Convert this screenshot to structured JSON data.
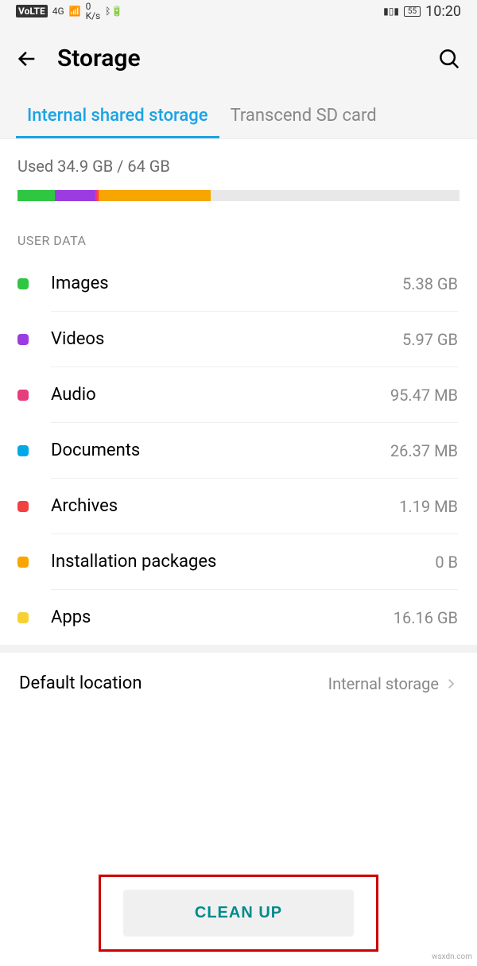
{
  "status_bar": {
    "volte": "VoLTE",
    "signal": "4G",
    "speed_top": "0",
    "speed_bottom": "K/s",
    "bluetooth_icon": "bluetooth",
    "vibrate_icon": "vibrate",
    "battery": "55",
    "time": "10:20"
  },
  "header": {
    "title": "Storage"
  },
  "tabs": [
    {
      "label": "Internal shared storage",
      "active": true
    },
    {
      "label": "Transcend SD card",
      "active": false
    }
  ],
  "usage": {
    "text": "Used 34.9 GB / 64 GB",
    "segments": [
      {
        "color": "#2FC641",
        "width": 8.4
      },
      {
        "color": "#9B3CE0",
        "width": 9.3
      },
      {
        "color": "#E73C7E",
        "width": 0.3
      },
      {
        "color": "#00A8E8",
        "width": 0.2
      },
      {
        "color": "#F04242",
        "width": 0.2
      },
      {
        "color": "#F7A600",
        "width": 25.3
      }
    ]
  },
  "section_header": "USER DATA",
  "categories": [
    {
      "name": "Images",
      "size": "5.38 GB",
      "color": "#2FC641"
    },
    {
      "name": "Videos",
      "size": "5.97 GB",
      "color": "#9B3CE0"
    },
    {
      "name": "Audio",
      "size": "95.47 MB",
      "color": "#E73C7E"
    },
    {
      "name": "Documents",
      "size": "26.37 MB",
      "color": "#00A8E8"
    },
    {
      "name": "Archives",
      "size": "1.19 MB",
      "color": "#F04242"
    },
    {
      "name": "Installation packages",
      "size": "0 B",
      "color": "#F7A600"
    },
    {
      "name": "Apps",
      "size": "16.16 GB",
      "color": "#F7D034"
    }
  ],
  "default_location": {
    "label": "Default location",
    "value": "Internal storage"
  },
  "clean_up_button": "CLEAN UP",
  "watermark": "wsxdn.com"
}
